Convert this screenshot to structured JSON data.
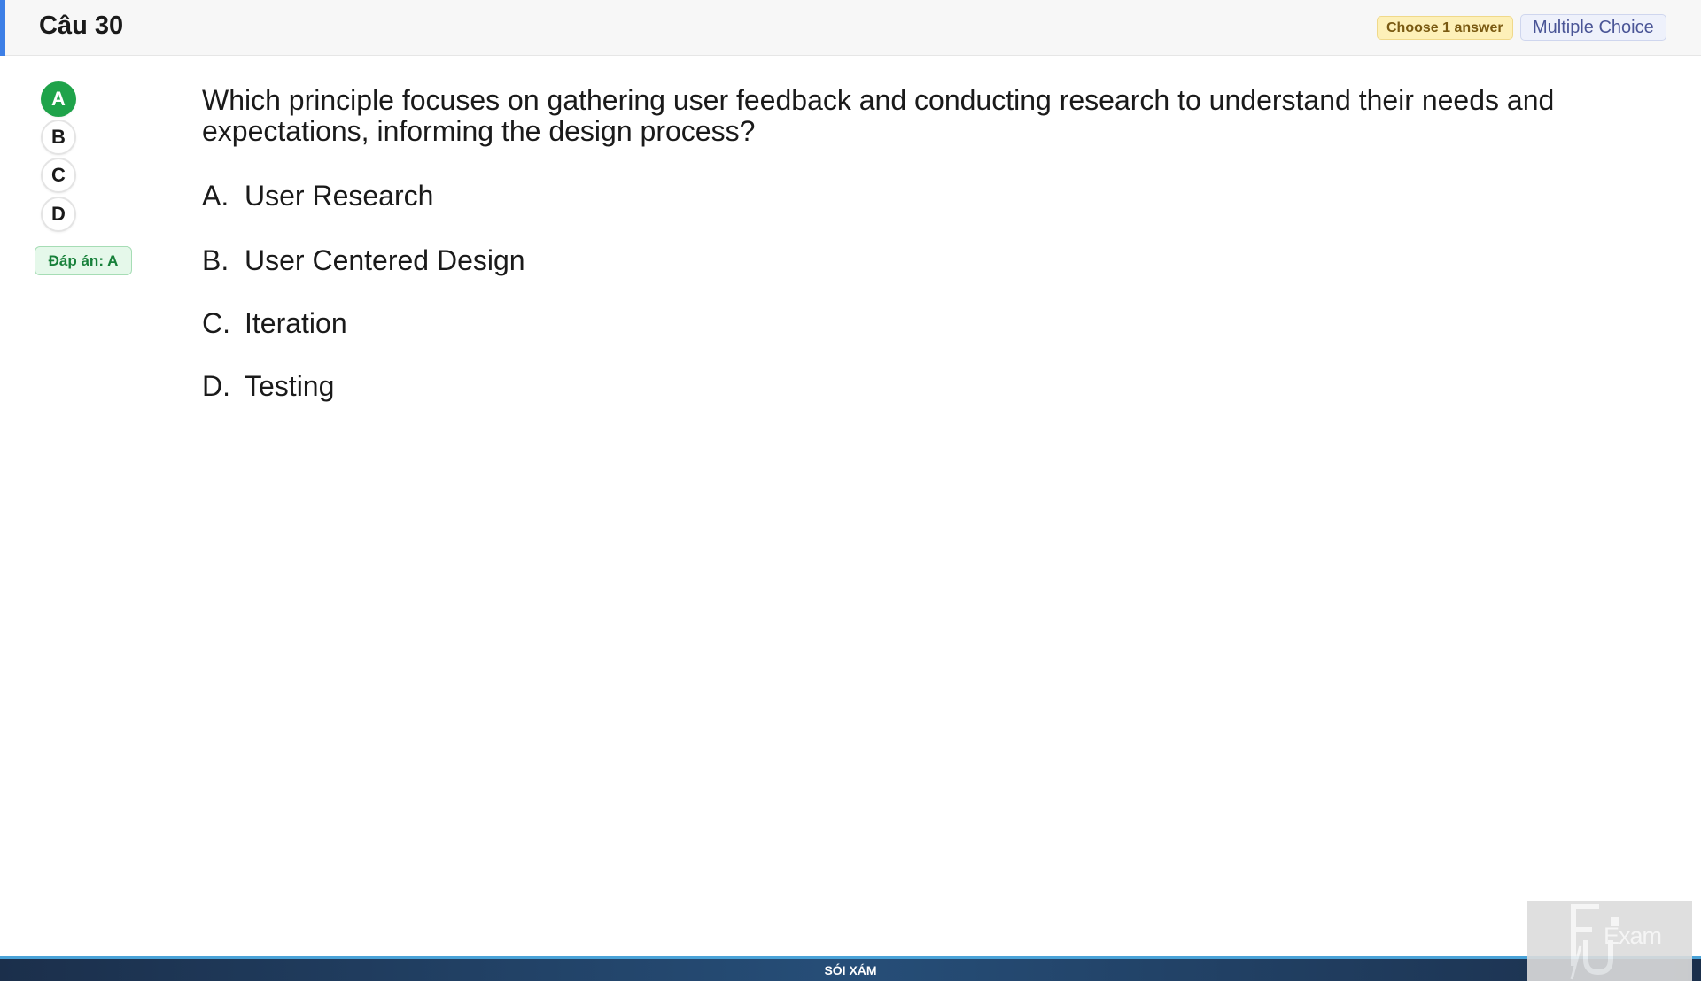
{
  "header": {
    "title": "Câu 30",
    "choose_badge": "Choose 1 answer",
    "type_badge": "Multiple Choice",
    "accent_color": "#3d7fe6"
  },
  "selector": {
    "options": [
      {
        "label": "A",
        "selected": true
      },
      {
        "label": "B",
        "selected": false
      },
      {
        "label": "C",
        "selected": false
      },
      {
        "label": "D",
        "selected": false
      }
    ],
    "answer_label": "Đáp án: A",
    "selected_color": "#1fa34a"
  },
  "question": {
    "text": "Which principle focuses on gathering user feedback and conducting research to understand their needs and expectations, informing the design process?",
    "choices": [
      {
        "letter": "A.",
        "text": "User Research"
      },
      {
        "letter": "B.",
        "text": "User Centered Design"
      },
      {
        "letter": "C.",
        "text": "Iteration"
      },
      {
        "letter": "D.",
        "text": "Testing"
      }
    ]
  },
  "footer": {
    "text": "SÓI XÁM"
  },
  "logo": {
    "text": "Exam",
    "icon": "fu-exam-logo-icon"
  }
}
